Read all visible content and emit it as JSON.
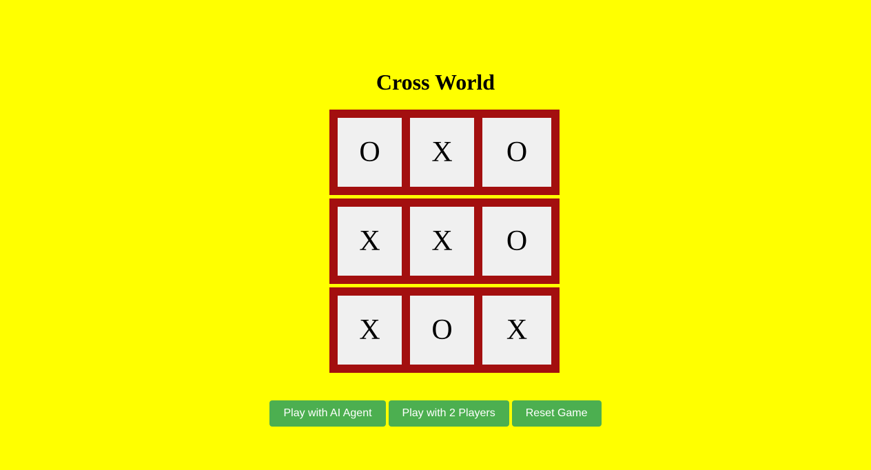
{
  "title": "Cross World",
  "board": [
    [
      "O",
      "X",
      "O"
    ],
    [
      "X",
      "X",
      "O"
    ],
    [
      "X",
      "O",
      "X"
    ]
  ],
  "buttons": {
    "ai": "Play with AI Agent",
    "two_players": "Play with 2 Players",
    "reset": "Reset Game"
  },
  "colors": {
    "background": "#ffff00",
    "board_frame": "#a30f0f",
    "cell": "#f0f0f0",
    "button": "#4caf50",
    "button_text": "#ffffff"
  }
}
